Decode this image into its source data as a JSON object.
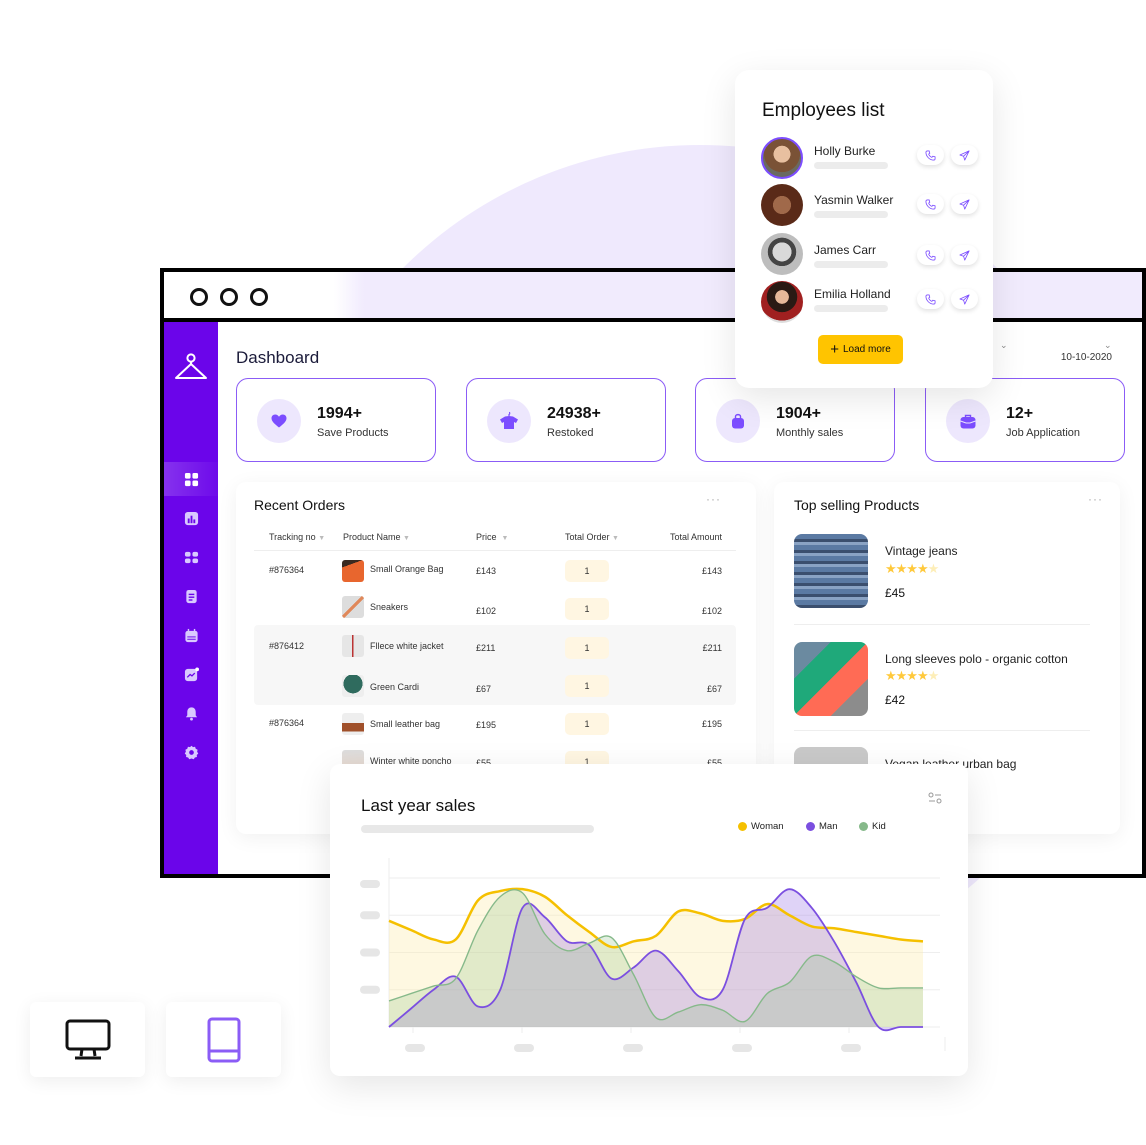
{
  "window": {
    "controls": [
      "dot",
      "dot",
      "dot"
    ]
  },
  "sidebar": {
    "logo": "hanger-icon",
    "items": [
      {
        "icon": "grid-icon",
        "active": true
      },
      {
        "icon": "bar-chart-icon",
        "active": false
      },
      {
        "icon": "apps-icon",
        "active": false
      },
      {
        "icon": "document-icon",
        "active": false
      },
      {
        "icon": "calendar-icon",
        "active": false
      },
      {
        "icon": "trend-icon",
        "active": false
      },
      {
        "icon": "bell-icon",
        "active": false
      },
      {
        "icon": "settings-icon",
        "active": false
      }
    ]
  },
  "header": {
    "title": "Dashboard",
    "date": "10-10-2020"
  },
  "stats": [
    {
      "value": "1994+",
      "label": "Save Products",
      "icon": "heart-icon"
    },
    {
      "value": "24938+",
      "label": "Restoked",
      "icon": "shirt-icon"
    },
    {
      "value": "1904+",
      "label": "Monthly sales",
      "icon": "bag-icon"
    },
    {
      "value": "12+",
      "label": "Job Application",
      "icon": "briefcase-icon"
    }
  ],
  "recent_orders": {
    "title": "Recent Orders",
    "more": "···",
    "columns": [
      "Tracking no",
      "Product Name",
      "Price",
      "Total Order",
      "Total Amount"
    ],
    "rows": [
      {
        "tracking": "#876364",
        "product": "Small Orange Bag",
        "price": "£143",
        "qty": "1",
        "amount": "£143"
      },
      {
        "tracking": "",
        "product": "Sneakers",
        "price": "£102",
        "qty": "1",
        "amount": "£102"
      },
      {
        "tracking": "#876412",
        "product": "Fllece white jacket",
        "price": "£211",
        "qty": "1",
        "amount": "£211"
      },
      {
        "tracking": "",
        "product": "Green Cardi",
        "price": "£67",
        "qty": "1",
        "amount": "£67"
      },
      {
        "tracking": "#876364",
        "product": "Small leather bag",
        "price": "£195",
        "qty": "1",
        "amount": "£195"
      },
      {
        "tracking": "",
        "product": "Winter white poncho",
        "price": "£55",
        "qty": "1",
        "amount": "£55"
      }
    ]
  },
  "top_products": {
    "title": "Top selling Products",
    "more": "···",
    "items": [
      {
        "name": "Vintage jeans",
        "rating": 4,
        "max_rating": 5,
        "price": "£45"
      },
      {
        "name": "Long sleeves polo - organic cotton",
        "rating": 4,
        "max_rating": 5,
        "price": "£42"
      },
      {
        "name": "Vegan leather urban bag"
      }
    ]
  },
  "employees": {
    "title": "Employees list",
    "people": [
      {
        "name": "Holly Burke"
      },
      {
        "name": "Yasmin Walker"
      },
      {
        "name": "James Carr"
      },
      {
        "name": "Emilia Holland"
      }
    ],
    "load_more": "Load more"
  },
  "sales": {
    "title": "Last year sales",
    "legend": [
      {
        "name": "Woman",
        "color": "#f5c000"
      },
      {
        "name": "Man",
        "color": "#7b4fe0"
      },
      {
        "name": "Kid",
        "color": "#86b98a"
      }
    ]
  },
  "chart_data": {
    "type": "area",
    "title": "Last year sales",
    "xlabel": "",
    "ylabel": "",
    "x": [
      0,
      1,
      2,
      3,
      4,
      5,
      6,
      7,
      8,
      9,
      10,
      11,
      12,
      13,
      14,
      15,
      16,
      17,
      18,
      19,
      20,
      21,
      22,
      23,
      24
    ],
    "ylim": [
      0,
      4
    ],
    "grid": true,
    "legend_position": "top-right",
    "series": [
      {
        "name": "Woman",
        "color": "#f5c000",
        "values": [
          2.85,
          2.6,
          2.35,
          2.35,
          3.4,
          3.65,
          3.7,
          3.5,
          3.0,
          2.55,
          2.15,
          2.3,
          2.45,
          3.1,
          3.05,
          2.85,
          2.9,
          3.3,
          3.0,
          2.7,
          2.65,
          2.55,
          2.45,
          2.35,
          2.3
        ]
      },
      {
        "name": "Man",
        "color": "#7b4fe0",
        "values": [
          0.0,
          0.5,
          1.0,
          1.35,
          0.55,
          1.0,
          3.2,
          2.95,
          2.3,
          2.2,
          1.3,
          1.6,
          2.05,
          1.5,
          0.8,
          1.0,
          2.9,
          3.2,
          3.7,
          3.2,
          2.3,
          1.2,
          0.0,
          0.0,
          0.0
        ]
      },
      {
        "name": "Kid",
        "color": "#86b98a",
        "values": [
          0.7,
          0.9,
          1.1,
          1.3,
          2.6,
          3.5,
          3.6,
          2.5,
          2.05,
          2.25,
          2.4,
          1.4,
          0.25,
          0.4,
          0.6,
          0.45,
          0.15,
          0.9,
          1.2,
          1.9,
          1.75,
          1.35,
          1.05,
          1.05,
          1.05
        ]
      }
    ]
  },
  "devices": [
    {
      "icon": "desktop-icon",
      "active": false
    },
    {
      "icon": "tablet-icon",
      "active": true
    }
  ]
}
